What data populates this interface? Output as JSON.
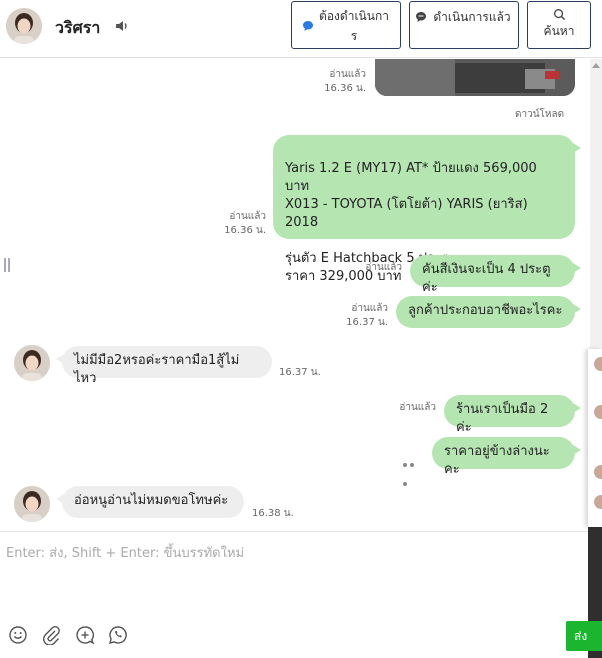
{
  "header": {
    "contact_name": "วริศรา",
    "btn_todo_label": "ต้องดำเนินการ",
    "btn_done_label": "ดำเนินการแล้ว",
    "btn_search_label": "ค้นหา",
    "todo_icon_color": "#2a7be4",
    "border_color": "#2c3e66"
  },
  "messages": {
    "m0_read": "อ่านแล้ว",
    "m0_time": "16.36 น.",
    "download": "ดาวน์โหลด",
    "m1_text": "Yaris 1.2 E (MY17) AT* ป้ายแดง 569,000 บาท\nX013 - TOYOTA (โตโยต้า) YARIS (ยาริส) 2018\n\nรุ่นตัว E Hatchback 5 ประตู\nราคา 329,000 บาท",
    "m1_read": "อ่านแล้ว",
    "m1_time": "16.36 น.",
    "m2_text": "คันสีเงินจะเป็น 4 ประตูค่ะ",
    "m2_read": "อ่านแล้ว",
    "m3_text": "ลูกค้าประกอบอาชีพอะไรคะ",
    "m3_read": "อ่านแล้ว",
    "m3_time": "16.37 น.",
    "m4_text": "ไม่มีมือ2หรอค่ะราคามือ1สู้ไม่ไหว",
    "m4_time": "16.37 น.",
    "m5_text": "ร้านเราเป็นมือ 2 ค่ะ",
    "m5_read": "อ่านแล้ว",
    "m6_text": "ราคาอยู่ข้างล่างนะคะ",
    "m7_text": "อ่อหนูอ่านไม่หมดขอโทษค่ะ",
    "m7_time": "16.38 น."
  },
  "composer": {
    "placeholder": "Enter: ส่ง, Shift + Enter: ขึ้นบรรทัดใหม่",
    "send_label": "ส่ง",
    "send_color": "#1bb52f"
  },
  "colors": {
    "outgoing_bubble": "#b5e6b2",
    "incoming_bubble": "#eeeeee"
  }
}
